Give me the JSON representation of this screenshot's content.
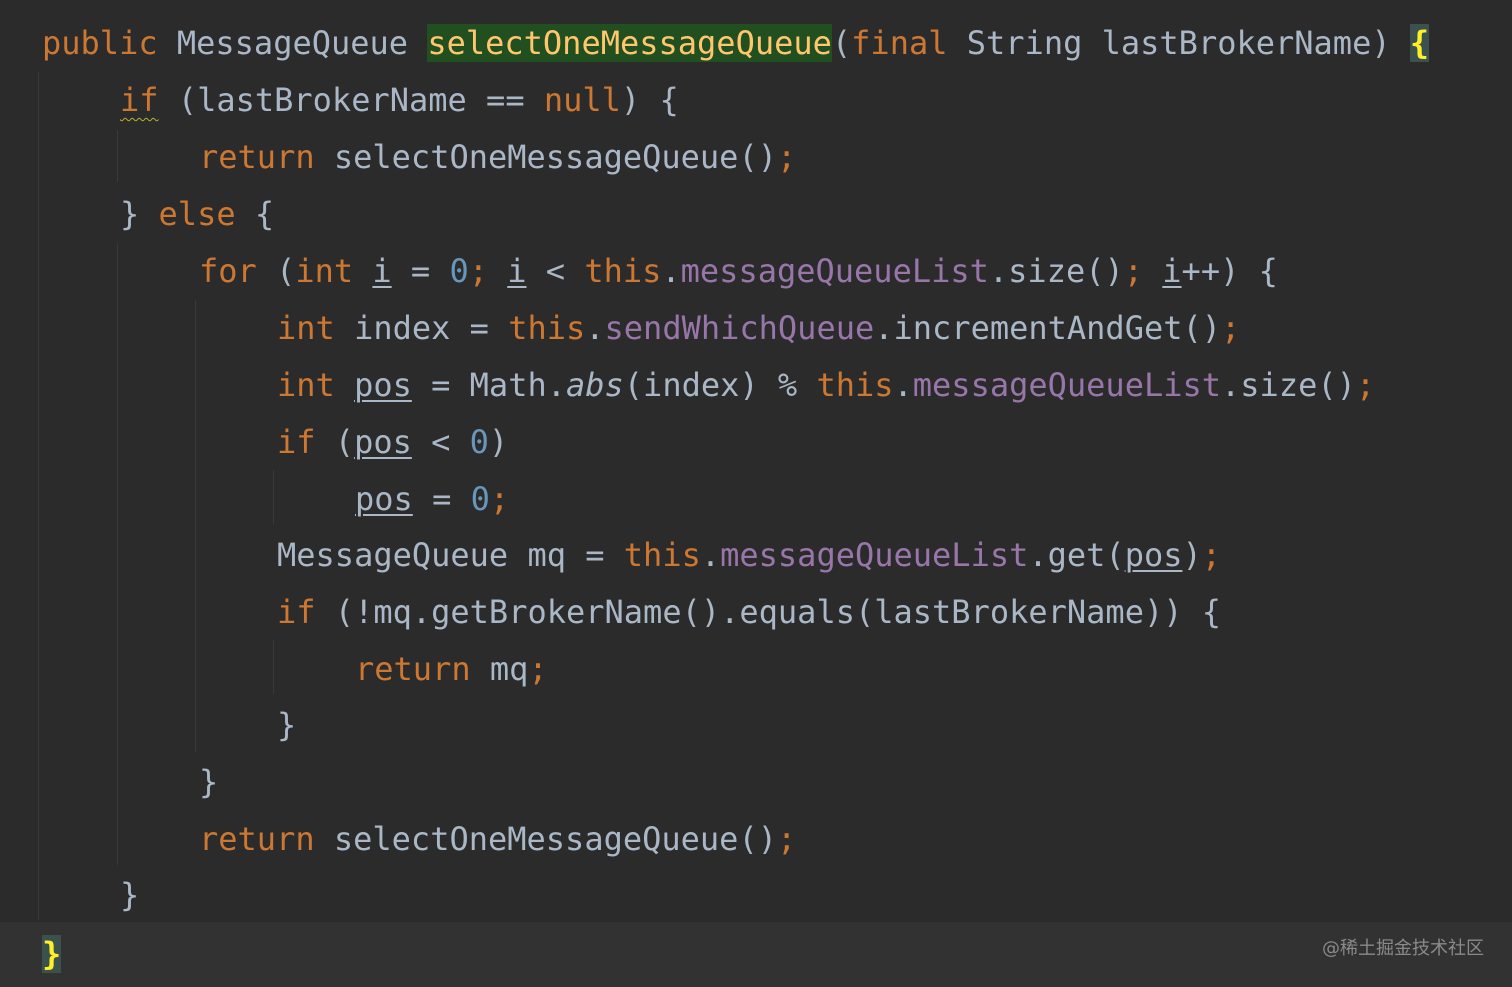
{
  "code_lines": [
    {
      "text": "public MessageQueue selectOneMessageQueue(final String lastBrokerName) {",
      "indent": 0
    },
    {
      "text": "if (lastBrokerName == null) {",
      "indent": 1
    },
    {
      "text": "return selectOneMessageQueue();",
      "indent": 2
    },
    {
      "text": "} else {",
      "indent": 1
    },
    {
      "text": "for (int i = 0; i < this.messageQueueList.size(); i++) {",
      "indent": 2
    },
    {
      "text": "int index = this.sendWhichQueue.incrementAndGet();",
      "indent": 3
    },
    {
      "text": "int pos = Math.abs(index) % this.messageQueueList.size();",
      "indent": 3
    },
    {
      "text": "if (pos < 0)",
      "indent": 3
    },
    {
      "text": "pos = 0;",
      "indent": 4
    },
    {
      "text": "MessageQueue mq = this.messageQueueList.get(pos);",
      "indent": 3
    },
    {
      "text": "if (!mq.getBrokerName().equals(lastBrokerName)) {",
      "indent": 3
    },
    {
      "text": "return mq;",
      "indent": 4
    },
    {
      "text": "}",
      "indent": 3
    },
    {
      "text": "}",
      "indent": 2
    },
    {
      "text": "return selectOneMessageQueue();",
      "indent": 2
    },
    {
      "text": "}",
      "indent": 1
    },
    {
      "text": "}",
      "indent": 0
    }
  ],
  "tokens": {
    "public": "public",
    "MessageQueue": "MessageQueue",
    "selectOneMessageQueue": "selectOneMessageQueue",
    "paren_open": "(",
    "paren_close": ")",
    "final": "final",
    "String": "String",
    "lastBrokerName": "lastBrokerName",
    "brace_open": "{",
    "brace_close": "}",
    "if": "if",
    "eqeq": "==",
    "null": "null",
    "return": "return",
    "call_empty": "()",
    "semi": ";",
    "else": "else",
    "for": "for",
    "int": "int",
    "i": "i",
    "eq": "=",
    "zero": "0",
    "lt": "<",
    "this": "this",
    "dot": ".",
    "messageQueueList": "messageQueueList",
    "size": "size",
    "incr": "++",
    "index": "index",
    "sendWhichQueue": "sendWhichQueue",
    "incrementAndGet": "incrementAndGet",
    "pos": "pos",
    "Math": "Math",
    "abs": "abs",
    "percent": "%",
    "mq": "mq",
    "get": "get",
    "not": "!",
    "getBrokerName": "getBrokerName",
    "equals": "equals"
  },
  "watermark": "@稀土掘金技术社区",
  "colors": {
    "background": "#2b2b2b",
    "keyword": "#cc7832",
    "number": "#6897bb",
    "field": "#9876aa",
    "method_decl": "#ffc66d",
    "default_text": "#a9b7c6",
    "brace_highlight": "#ffef28",
    "method_highlight_bg": "#214f1f"
  }
}
